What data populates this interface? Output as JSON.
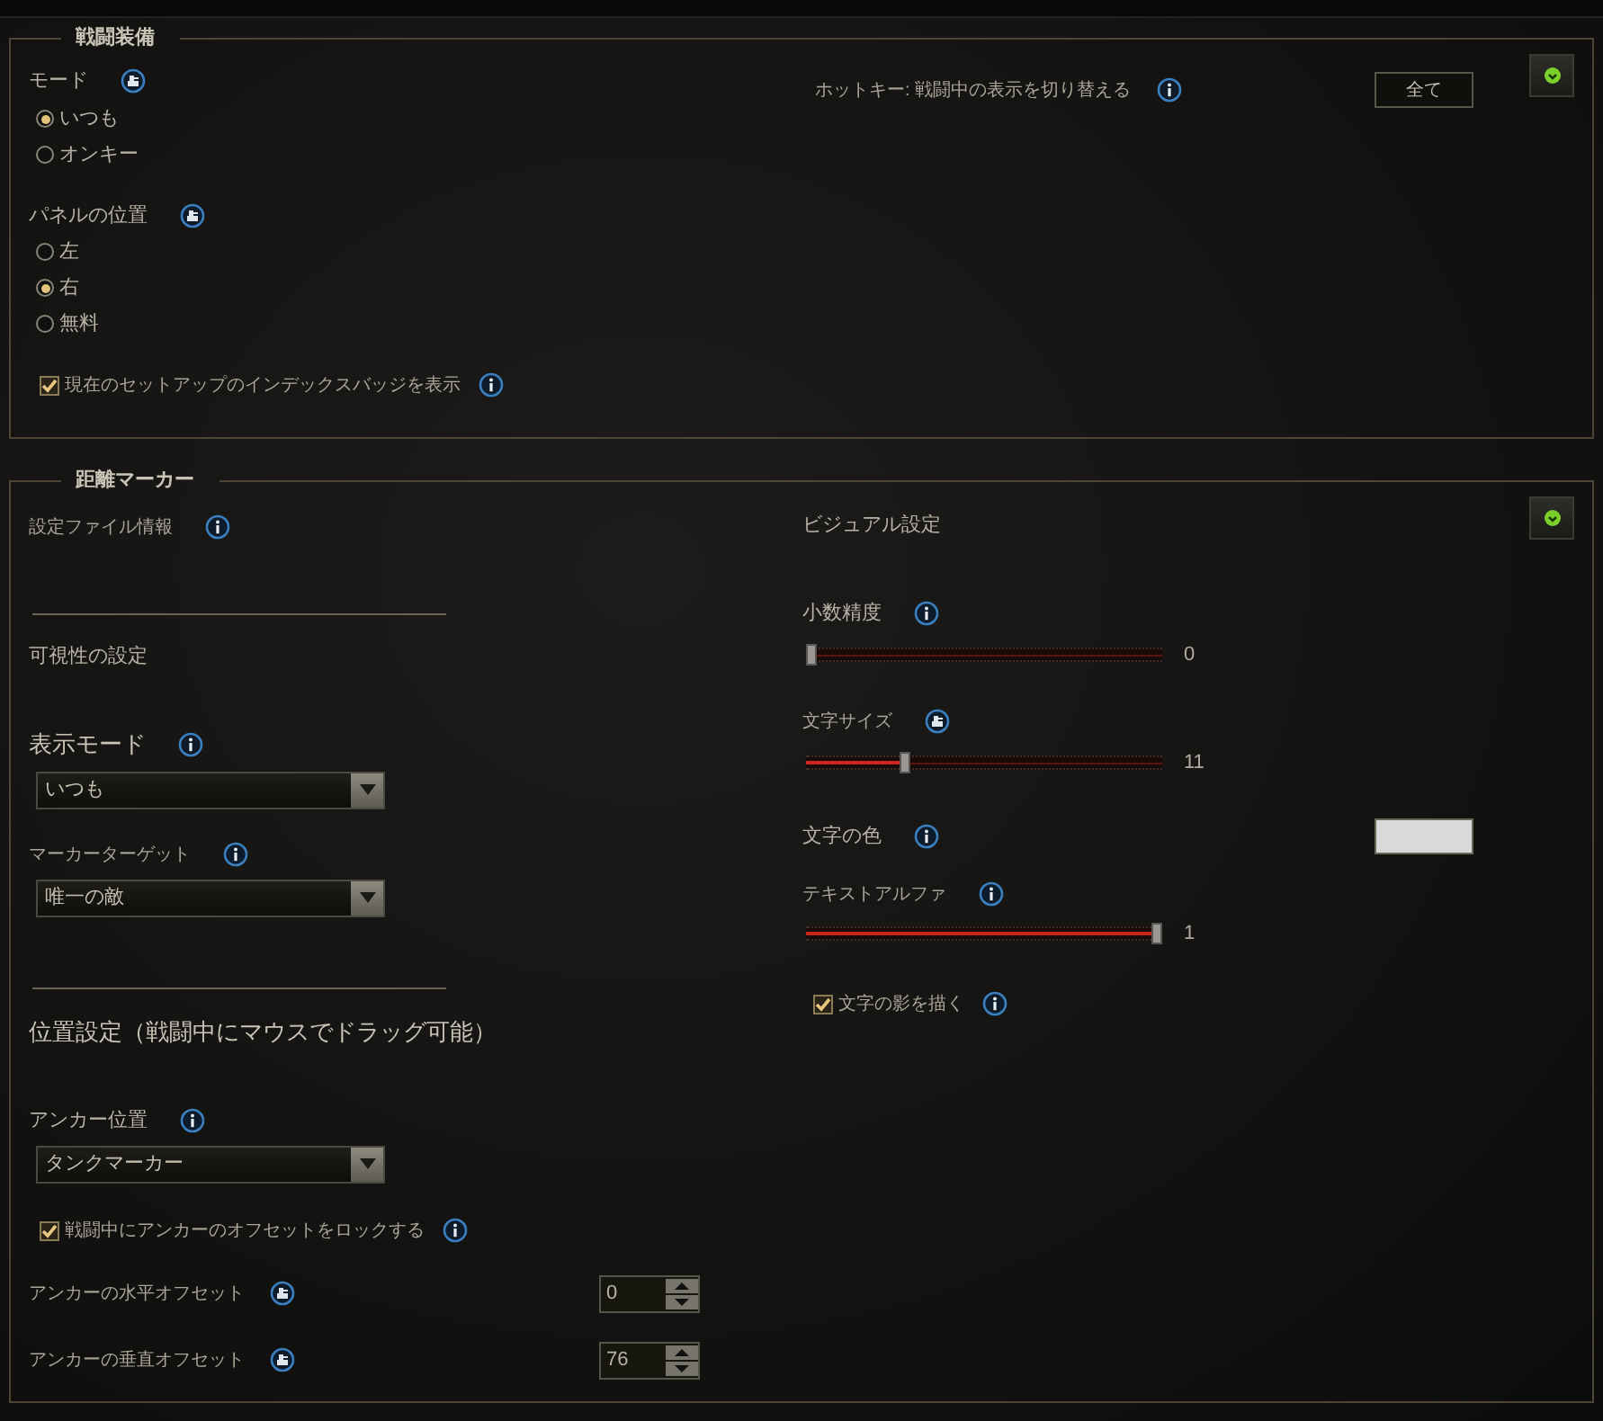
{
  "sections": [
    {
      "title": "戦闘装備",
      "left": [
        {
          "kind": "label",
          "text": "モード"
        },
        {
          "kind": "radio",
          "text": "いつも",
          "selected": true
        },
        {
          "kind": "radio",
          "text": "オンキー",
          "selected": false
        },
        {
          "kind": "label",
          "text": "パネルの位置"
        },
        {
          "kind": "radio",
          "text": "左",
          "selected": false
        },
        {
          "kind": "radio",
          "text": "右",
          "selected": true
        },
        {
          "kind": "radio",
          "text": "無料",
          "selected": false
        },
        {
          "kind": "checkbox",
          "text": "現在のセットアップのインデックスバッジを表示",
          "checked": true
        }
      ],
      "right": [
        {
          "kind": "hotkey",
          "text": "ホットキー: 戦闘中の表示を切り替える",
          "button": "全て"
        }
      ]
    },
    {
      "title": "距離マーカー",
      "left": [
        {
          "kind": "caption",
          "text": "設定ファイル情報"
        },
        {
          "kind": "divider"
        },
        {
          "kind": "label",
          "text": "可視性の設定"
        },
        {
          "kind": "heading",
          "text": "表示モード"
        },
        {
          "kind": "dropdown",
          "value": "いつも"
        },
        {
          "kind": "caption",
          "text": "マーカーターゲット"
        },
        {
          "kind": "dropdown",
          "value": "唯一の敵"
        },
        {
          "kind": "divider"
        },
        {
          "kind": "heading",
          "text": "位置設定（戦闘中にマウスでドラッグ可能）"
        },
        {
          "kind": "label",
          "text": "アンカー位置"
        },
        {
          "kind": "dropdown",
          "value": "タンクマーカー"
        },
        {
          "kind": "checkbox",
          "text": "戦闘中にアンカーのオフセットをロックする",
          "checked": true
        },
        {
          "kind": "spinner",
          "text": "アンカーの水平オフセット",
          "value": "0"
        },
        {
          "kind": "spinner",
          "text": "アンカーの垂直オフセット",
          "value": "76"
        }
      ],
      "right": [
        {
          "kind": "label",
          "text": "ビジュアル設定"
        },
        {
          "kind": "label",
          "text": "小数精度"
        },
        {
          "kind": "slider",
          "level": 0,
          "reading": "0"
        },
        {
          "kind": "caption",
          "text": "文字サイズ"
        },
        {
          "kind": "slider",
          "level": 0.27,
          "reading": "11"
        },
        {
          "kind": "color",
          "text": "文字の色",
          "color": "#d9d9d9"
        },
        {
          "kind": "caption",
          "text": "テキストアルファ"
        },
        {
          "kind": "slider",
          "level": 1,
          "reading": "1"
        },
        {
          "kind": "checkbox",
          "text": "文字の影を描く",
          "checked": true
        }
      ]
    }
  ]
}
